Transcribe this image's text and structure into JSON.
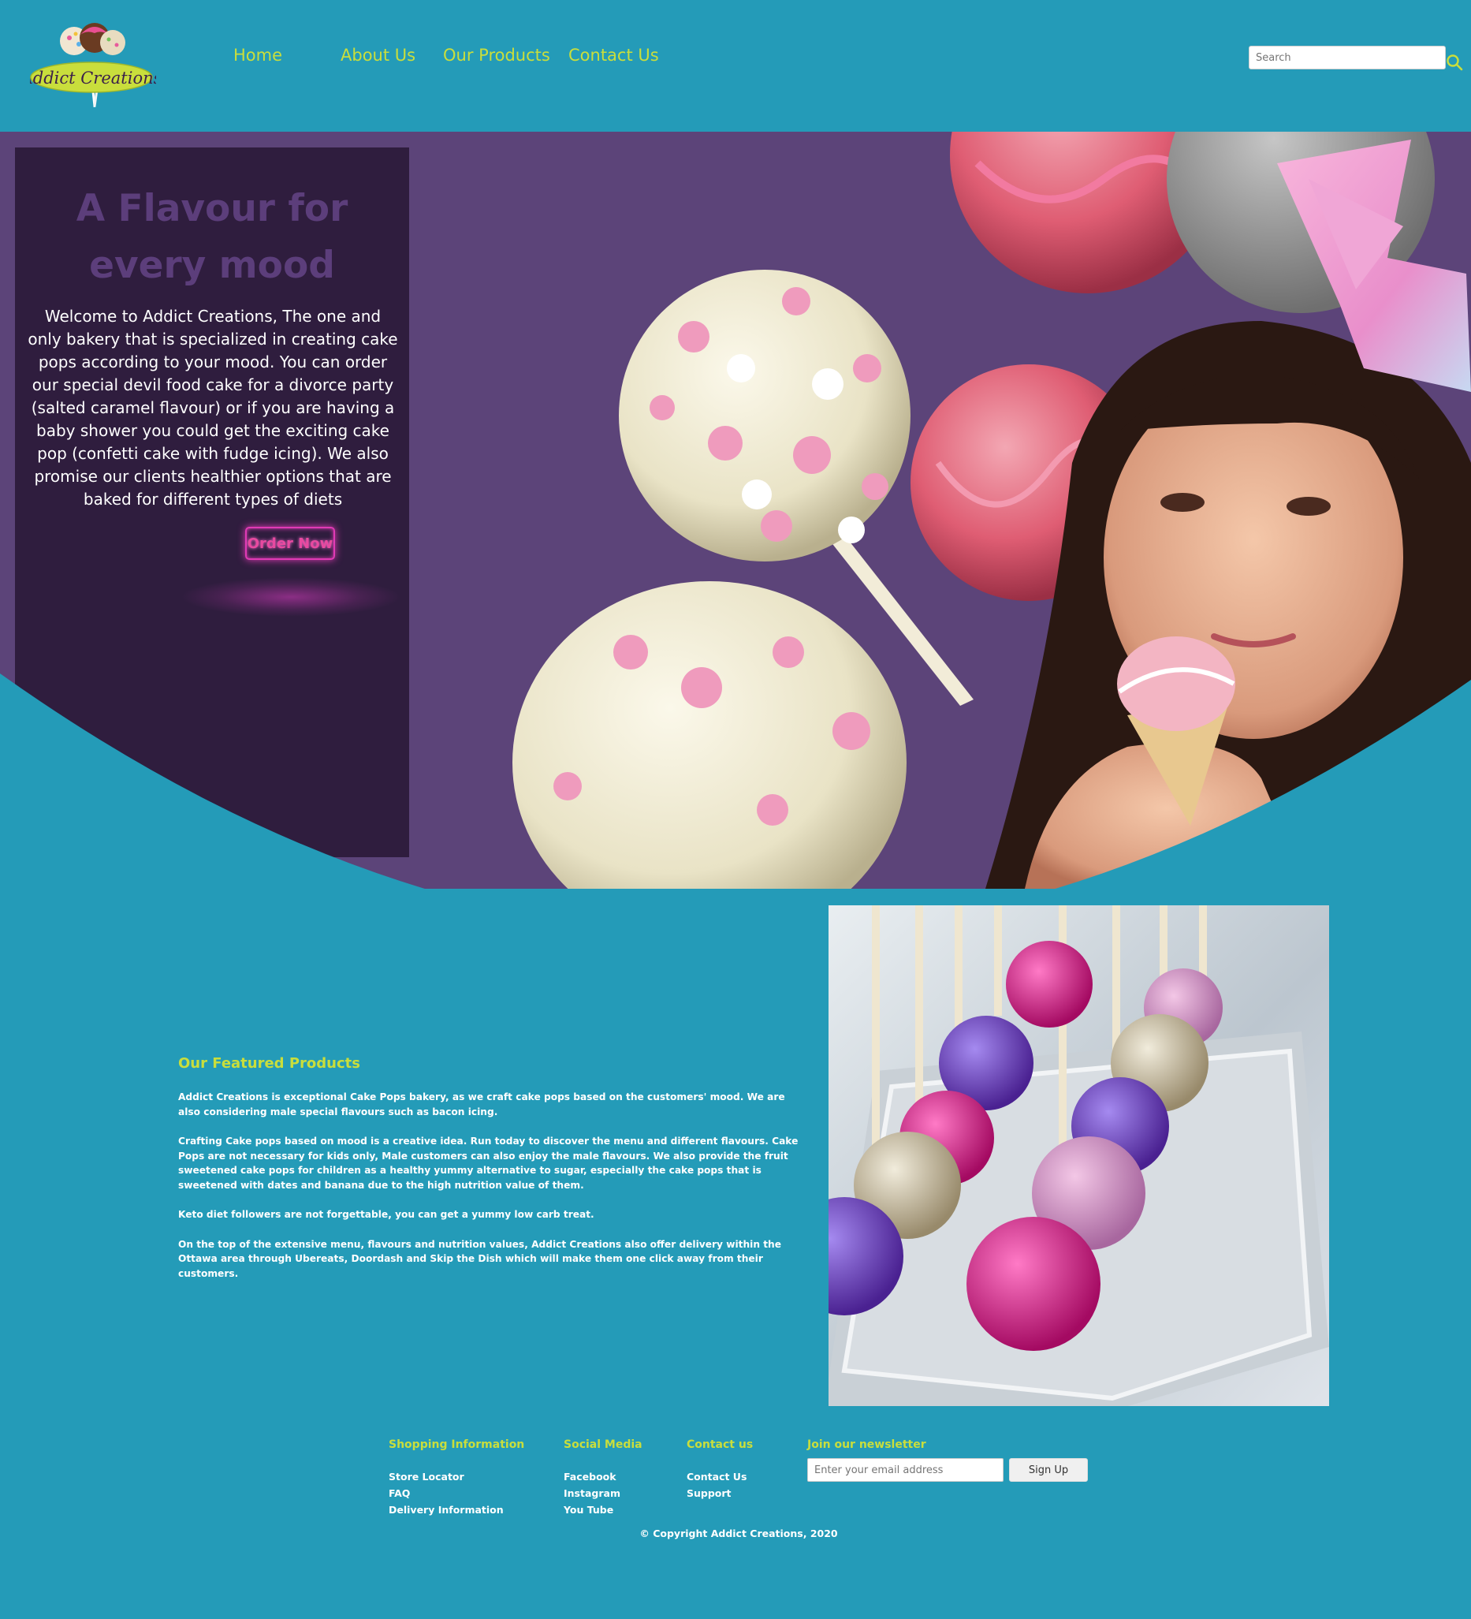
{
  "brand": {
    "logo_text": "Addict Creations"
  },
  "nav": {
    "home": "Home",
    "about": "About Us",
    "products": "Our Products",
    "contact": "Contact Us"
  },
  "search": {
    "placeholder": "Search"
  },
  "hero": {
    "title_line1": "A Flavour for",
    "title_line2": "every mood",
    "text": "Welcome to Addict Creations, The one and only bakery that is specialized in creating cake pops according to your mood. You can order our special devil food cake for a divorce party (salted caramel flavour) or if you are having a baby shower you could get the exciting cake pop (confetti cake with fudge icing). We also promise our clients healthier options that are baked for different types of diets",
    "cta": "Order Now"
  },
  "featured": {
    "title": "Our Featured Products",
    "paragraphs": [
      "Addict Creations is exceptional Cake Pops bakery, as we craft cake pops based on the customers' mood. We are also considering male special flavours such as bacon icing.",
      "Crafting Cake pops based on mood is a creative idea. Run today to discover the menu and different flavours. Cake Pops are not necessary for kids only, Male customers can also enjoy the male flavours. We also provide the fruit sweetened cake pops for children as a healthy yummy alternative to sugar, especially the cake pops that is sweetened with dates and banana due to the high nutrition value of them.",
      "Keto diet followers are not forgettable, you can get a yummy low carb treat.",
      "On the top of the extensive menu, flavours and nutrition values, Addict Creations also offer delivery within the Ottawa area through Ubereats, Doordash and Skip the Dish which will make them one click away from their customers."
    ]
  },
  "footer": {
    "shopping": {
      "title": "Shopping Information",
      "links": [
        "Store Locator",
        "FAQ",
        "Delivery Information"
      ]
    },
    "social": {
      "title": "Social Media",
      "links": [
        "Facebook",
        "Instagram",
        "You Tube"
      ]
    },
    "contact": {
      "title": "Contact us",
      "links": [
        "Contact Us",
        "Support"
      ]
    },
    "newsletter": {
      "title": "Join our newsletter",
      "placeholder": "Enter your email address",
      "button": "Sign Up"
    },
    "copyright": "© Copyright Addict Creations, 2020"
  },
  "colors": {
    "background": "#249bb8",
    "accent": "#c9de3c",
    "hero_panel": "#2f1d3e",
    "hero_title": "#5c3e7b",
    "neon": "#e03ab5"
  },
  "icons": {
    "search": "search-icon",
    "logo": "cake-pops-logo"
  }
}
